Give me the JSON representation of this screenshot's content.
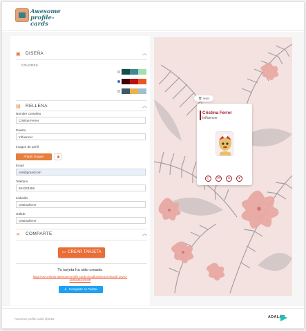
{
  "header": {
    "logo_line1": "Awesome",
    "logo_line2": "profile-cards"
  },
  "design": {
    "title": "DISEÑA",
    "colors_label": "COLORES",
    "palettes": [
      {
        "selected": false,
        "colors": [
          "#114e4e",
          "#438792",
          "#a2deaf"
        ]
      },
      {
        "selected": true,
        "colors": [
          "#420101",
          "#bd1010",
          "#e95626"
        ]
      },
      {
        "selected": false,
        "colors": [
          "#3e5b65",
          "#eab052",
          "#a0c0cf"
        ]
      }
    ]
  },
  "fill": {
    "title": "RELLENA",
    "fields": {
      "name": {
        "label": "Nombre completo",
        "value": "Cristina Ferrer"
      },
      "job": {
        "label": "Puesto",
        "value": "Influencer"
      },
      "image": {
        "label": "Imagen de perfil",
        "button": "Añadir imagen"
      },
      "email": {
        "label": "Email",
        "value": "cris@gmail.com"
      },
      "phone": {
        "label": "Teléfono",
        "value": "654323456"
      },
      "linkedin": {
        "label": "Linkedin",
        "value": "cristinaferrer"
      },
      "github": {
        "label": "Github",
        "value": "cristinaferrer"
      }
    }
  },
  "share": {
    "title": "COMPARTE",
    "create_button": "CREAR TARJETA",
    "created_text": "Tu tarjeta ha sido creada:",
    "link": "https://us-central1-awesome-profile-cards.cloudfunctions.net/card/-LmAd-aW3eWHI12dJP",
    "twitter_button": "Compartir en Twitter"
  },
  "preview": {
    "reset_label": "reset",
    "card_name": "Cristina Ferrer",
    "card_job": "Influencer",
    "accent": "#9b1b27",
    "icons": [
      "phone-icon",
      "mail-icon",
      "linkedin-icon",
      "github-icon"
    ]
  },
  "footer": {
    "copyright": "Awesome profile-cards @2018",
    "brand": "ADALAB"
  }
}
